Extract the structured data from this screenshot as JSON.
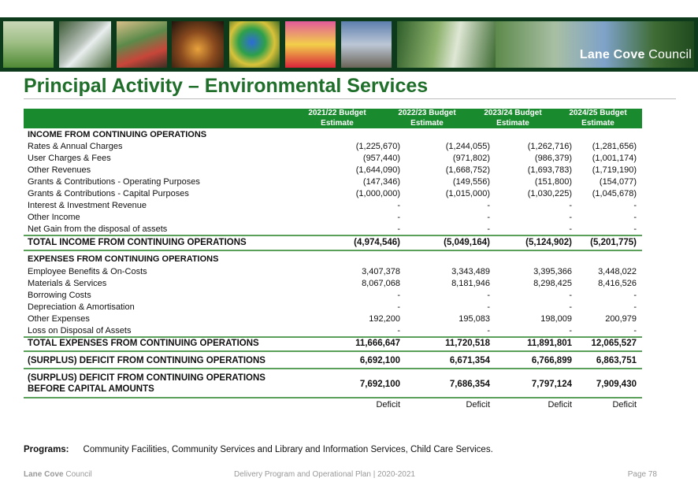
{
  "banner": {
    "logo_bold": "Lane Cove",
    "logo_light": "Council",
    "photos": [
      "golf-course-photo",
      "waterfall-photo",
      "festival-photo",
      "market-night-photo",
      "parrot-photo",
      "dancer-photo",
      "building-photo",
      "park-photo",
      "harbour-photo"
    ]
  },
  "title": "Principal Activity – Environmental Services",
  "headers": [
    {
      "line1": "2021/22 Budget",
      "line2": "Estimate"
    },
    {
      "line1": "2022/23 Budget",
      "line2": "Estimate"
    },
    {
      "line1": "2023/24 Budget",
      "line2": "Estimate"
    },
    {
      "line1": "2024/25 Budget",
      "line2": "Estimate"
    }
  ],
  "income": {
    "heading": "INCOME FROM CONTINUING OPERATIONS",
    "rows": [
      {
        "label": "Rates & Annual Charges",
        "values": [
          "(1,225,670)",
          "(1,244,055)",
          "(1,262,716)",
          "(1,281,656)"
        ]
      },
      {
        "label": "User Charges & Fees",
        "values": [
          "(957,440)",
          "(971,802)",
          "(986,379)",
          "(1,001,174)"
        ]
      },
      {
        "label": "Other Revenues",
        "values": [
          "(1,644,090)",
          "(1,668,752)",
          "(1,693,783)",
          "(1,719,190)"
        ]
      },
      {
        "label": "Grants & Contributions - Operating Purposes",
        "values": [
          "(147,346)",
          "(149,556)",
          "(151,800)",
          "(154,077)"
        ]
      },
      {
        "label": "Grants & Contributions - Capital Purposes",
        "values": [
          "(1,000,000)",
          "(1,015,000)",
          "(1,030,225)",
          "(1,045,678)"
        ]
      },
      {
        "label": "Interest & Investment Revenue",
        "values": [
          "-",
          "-",
          "-",
          "-"
        ]
      },
      {
        "label": "Other Income",
        "values": [
          "-",
          "-",
          "-",
          "-"
        ]
      },
      {
        "label": "Net Gain from the disposal of assets",
        "values": [
          "-",
          "-",
          "-",
          "-"
        ]
      }
    ],
    "total": {
      "label": "TOTAL INCOME FROM CONTINUING OPERATIONS",
      "values": [
        "(4,974,546)",
        "(5,049,164)",
        "(5,124,902)",
        "(5,201,775)"
      ]
    }
  },
  "expenses": {
    "heading": "EXPENSES FROM CONTINUING OPERATIONS",
    "rows": [
      {
        "label": "Employee Benefits & On-Costs",
        "values": [
          "3,407,378",
          "3,343,489",
          "3,395,366",
          "3,448,022"
        ]
      },
      {
        "label": "Materials & Services",
        "values": [
          "8,067,068",
          "8,181,946",
          "8,298,425",
          "8,416,526"
        ]
      },
      {
        "label": "Borrowing Costs",
        "values": [
          "-",
          "-",
          "-",
          "-"
        ]
      },
      {
        "label": "Depreciation & Amortisation",
        "values": [
          "-",
          "-",
          "-",
          "-"
        ]
      },
      {
        "label": "Other Expenses",
        "values": [
          "192,200",
          "195,083",
          "198,009",
          "200,979"
        ]
      },
      {
        "label": "Loss on Disposal of Assets",
        "values": [
          "-",
          "-",
          "-",
          "-"
        ]
      }
    ],
    "total": {
      "label": "TOTAL EXPENSES FROM CONTINUING OPERATIONS",
      "values": [
        "11,666,647",
        "11,720,518",
        "11,891,801",
        "12,065,527"
      ]
    }
  },
  "surplus": {
    "label": "(SURPLUS) DEFICIT FROM CONTINUING OPERATIONS",
    "values": [
      "6,692,100",
      "6,671,354",
      "6,766,899",
      "6,863,751"
    ]
  },
  "surplus_before": {
    "label1": "(SURPLUS) DEFICIT FROM CONTINUING OPERATIONS",
    "label2": "BEFORE CAPITAL AMOUNTS",
    "values": [
      "7,692,100",
      "7,686,354",
      "7,797,124",
      "7,909,430"
    ]
  },
  "result_labels": [
    "Deficit",
    "Deficit",
    "Deficit",
    "Deficit"
  ],
  "programs": {
    "label": "Programs:",
    "text": "Community Facilities, Community Services and Library and Information Services, Child Care Services."
  },
  "footer": {
    "org_bold": "Lane Cove",
    "org_light": "Council",
    "doc": "Delivery Program and Operational Plan | 2020-2021",
    "page": "Page 78"
  },
  "colors": {
    "brand_green": "#1f6f2b",
    "header_green": "#1a8a2e",
    "banner_dark": "#0d3a1a",
    "rule_green": "#5aa05a"
  }
}
